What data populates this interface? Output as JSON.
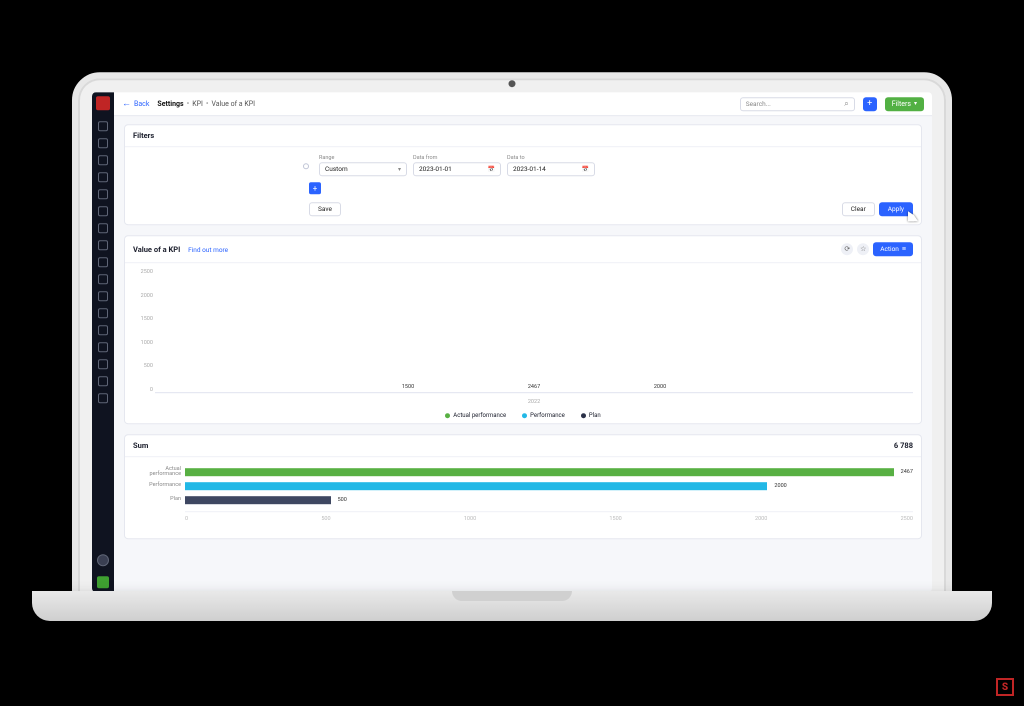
{
  "sidebar": {
    "icon_count": 18
  },
  "topbar": {
    "back": "Back",
    "settings": "Settings",
    "crumb1": "KPI",
    "crumb2": "Value of a KPI",
    "search_placeholder": "Search...",
    "filters_btn": "Filters"
  },
  "filters": {
    "title": "Filters",
    "range_label": "Range",
    "range_value": "Custom",
    "date_from_label": "Data from",
    "date_from_value": "2023-01-01",
    "date_to_label": "Data to",
    "date_to_value": "2023-01-14",
    "save": "Save",
    "clear": "Clear",
    "apply": "Apply"
  },
  "kpi": {
    "title": "Value of a KPI",
    "link": "Find out more",
    "action": "Action"
  },
  "chart_data": {
    "type": "bar",
    "categories": [
      "2022"
    ],
    "series": [
      {
        "name": "Plan",
        "color": "#3e4761",
        "values": [
          1500
        ]
      },
      {
        "name": "Actual performance",
        "color": "#58b043",
        "values": [
          2467
        ]
      },
      {
        "name": "Performance",
        "color": "#22b8e6",
        "values": [
          2000
        ]
      }
    ],
    "ylim": [
      0,
      2500
    ],
    "yticks": [
      "2500",
      "2000",
      "1500",
      "1000",
      "500",
      "0"
    ],
    "legend": [
      "Actual performance",
      "Performance",
      "Plan"
    ],
    "legend_colors": [
      "#58b043",
      "#22b8e6",
      "#2b3148"
    ]
  },
  "sum": {
    "title": "Sum",
    "total": "6 788",
    "rows": [
      {
        "label": "Actual\nperformance",
        "value": 2467,
        "color": "#58b043"
      },
      {
        "label": "Performance",
        "value": 2000,
        "color": "#22b8e6"
      },
      {
        "label": "Plan",
        "value": 500,
        "color": "#3e4761"
      }
    ],
    "xmax": 2500,
    "xticks": [
      "0",
      "500",
      "1000",
      "1500",
      "2000",
      "2500"
    ]
  }
}
